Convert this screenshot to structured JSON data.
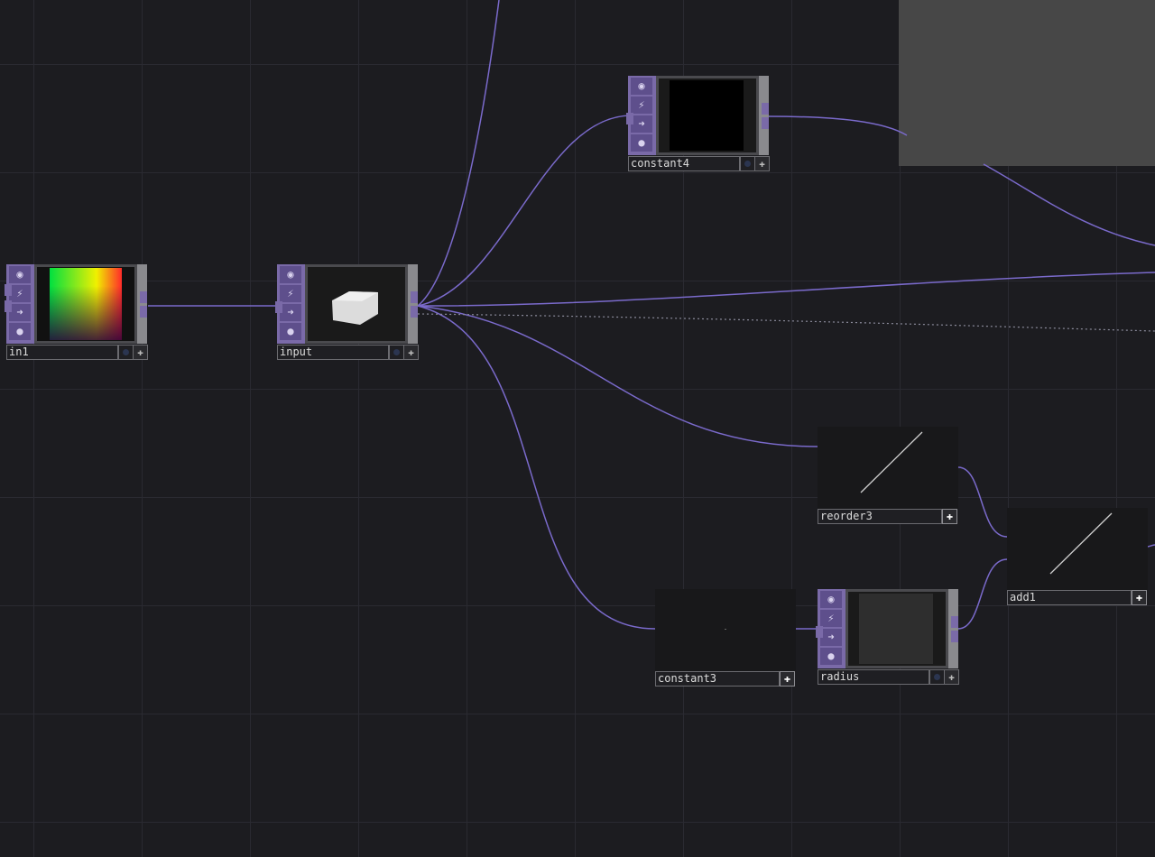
{
  "colors": {
    "background": "#1c1c20",
    "wire": "#7a6acb",
    "node_side": "#7a6aa8",
    "panel_gray": "#474747"
  },
  "side_icons": [
    "viewer-icon",
    "bypass-icon",
    "lock-arrow-icon",
    "clone-icon"
  ],
  "side_icon_glyphs": [
    "◉",
    "⚡",
    "➜",
    "●"
  ],
  "nodes": {
    "in1": {
      "label": "in1"
    },
    "input": {
      "label": "input"
    },
    "constant4": {
      "label": "constant4"
    },
    "reorder3": {
      "label": "reorder3"
    },
    "add1": {
      "label": "add1"
    },
    "constant3": {
      "label": "constant3"
    },
    "radius": {
      "label": "radius"
    }
  },
  "plus_glyph": "✚"
}
